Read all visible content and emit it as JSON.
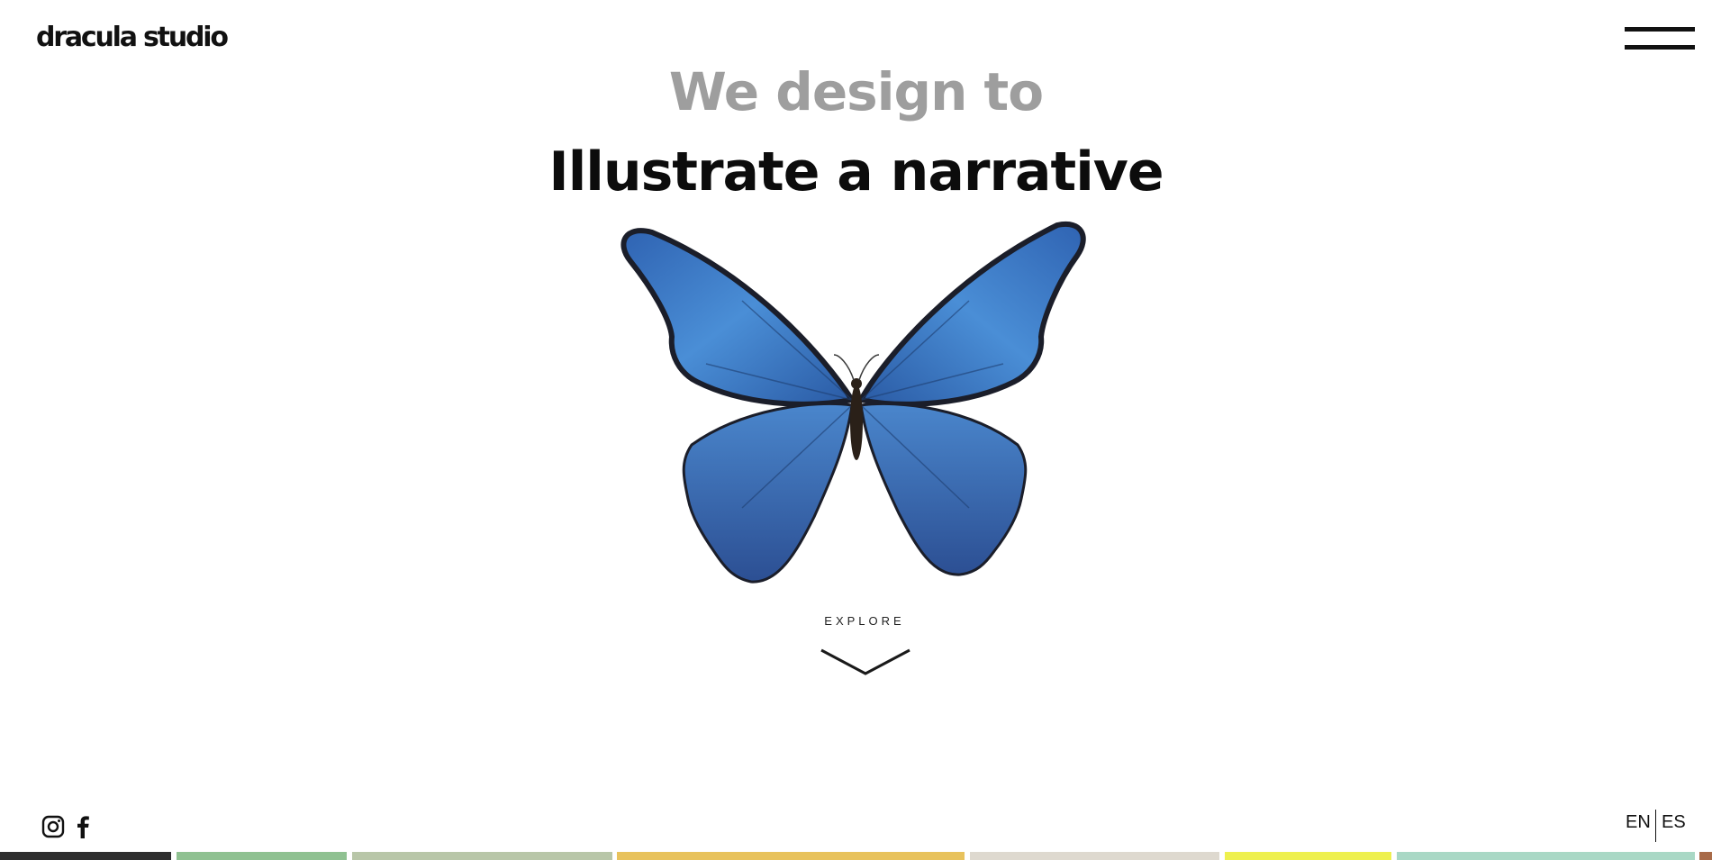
{
  "header": {
    "logo_text": "dracula studio"
  },
  "hero": {
    "line1": "We design to",
    "line2": "Illustrate a narrative",
    "explore_label": "EXPLORE"
  },
  "social": {
    "icons": [
      "instagram-icon",
      "facebook-icon"
    ]
  },
  "language": {
    "options": [
      "EN",
      "ES"
    ]
  },
  "colors": {
    "line1": "#9e9e9e",
    "line2": "#0c0c0c",
    "butterfly_blue": "#3b78c4"
  }
}
